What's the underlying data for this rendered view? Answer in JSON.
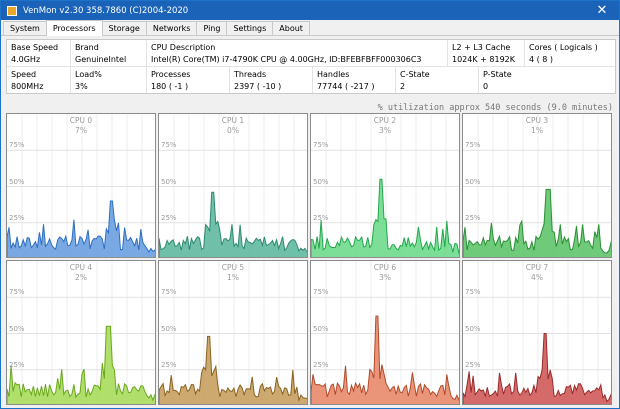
{
  "window": {
    "title": "VenMon v2.30 358.7860 (C)2004-2020",
    "close": "✕"
  },
  "tabs": [
    "System",
    "Processors",
    "Storage",
    "Networks",
    "Ping",
    "Settings",
    "About"
  ],
  "active_tab": "Processors",
  "info": {
    "base_speed": {
      "label": "Base Speed",
      "value": "4.0GHz"
    },
    "brand": {
      "label": "Brand",
      "value": "GenuineIntel"
    },
    "cpu_desc": {
      "label": "CPU Description",
      "value": "Intel(R) Core(TM) i7-4790K CPU @ 4.00GHz, ID:BFEBFBFF000306C3"
    },
    "cache": {
      "label": "L2 + L3 Cache",
      "value": "1024K + 8192K"
    },
    "cores": {
      "label": "Cores ( Logicals )",
      "value": "4 ( 8 )"
    },
    "speed": {
      "label": "Speed",
      "value": "800MHz"
    },
    "load": {
      "label": "Load%",
      "value": "3%"
    },
    "processes": {
      "label": "Processes",
      "value": "180  ( -1 )"
    },
    "threads": {
      "label": "Threads",
      "value": "2397  ( -10 )"
    },
    "handles": {
      "label": "Handles",
      "value": "77744  ( -217 )"
    },
    "cstate": {
      "label": "C-State",
      "value": "2"
    },
    "pstate": {
      "label": "P-State",
      "value": "0"
    }
  },
  "utilization_note": "% utilization approx 540 seconds (9.0 minutes)",
  "grid_labels": [
    "75%",
    "50%",
    "25%"
  ],
  "cpus": [
    {
      "name": "CPU 0",
      "pct": "7%",
      "color": "#6a9fe0",
      "line": "#2e6fc0",
      "peak": 0.4
    },
    {
      "name": "CPU 1",
      "pct": "0%",
      "color": "#5fb8a0",
      "line": "#2e8a70",
      "peak": 0.46
    },
    {
      "name": "CPU 2",
      "pct": "3%",
      "color": "#6fdc8c",
      "line": "#22a84a",
      "peak": 0.55
    },
    {
      "name": "CPU 3",
      "pct": "1%",
      "color": "#5fc46a",
      "line": "#2a8f35",
      "peak": 0.48
    },
    {
      "name": "CPU 4",
      "pct": "2%",
      "color": "#a8dc5c",
      "line": "#6aa81e",
      "peak": 0.55
    },
    {
      "name": "CPU 5",
      "pct": "1%",
      "color": "#c8a060",
      "line": "#8a6222",
      "peak": 0.48
    },
    {
      "name": "CPU 6",
      "pct": "3%",
      "color": "#e88a6c",
      "line": "#b24a2a",
      "peak": 0.62
    },
    {
      "name": "CPU 7",
      "pct": "4%",
      "color": "#d05a5a",
      "line": "#9a2a2a",
      "peak": 0.5
    }
  ]
}
